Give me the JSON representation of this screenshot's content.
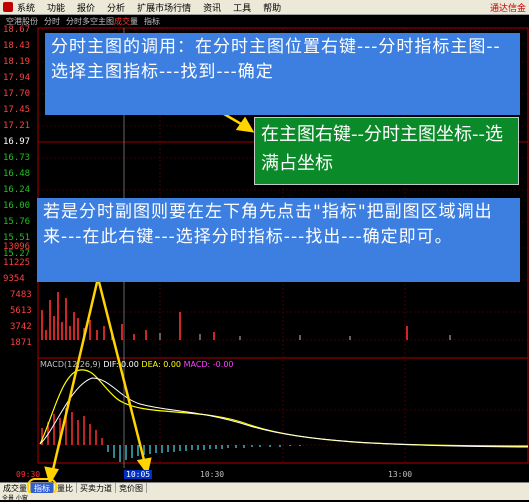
{
  "menubar": {
    "items": [
      "系统",
      "功能",
      "报价",
      "分析",
      "扩展市场行情",
      "资讯",
      "工具",
      "帮助"
    ],
    "right_text": "通达信金"
  },
  "toolbar": {
    "stock_name": "空港股份",
    "items": [
      "分时",
      "分时多空主图"
    ],
    "highlight": "成交",
    "item_after": "量",
    "last": "指标"
  },
  "price_axis": [
    "18.67",
    "18.43",
    "18.19",
    "17.94",
    "17.70",
    "17.45",
    "17.21",
    "16.97",
    "16.73",
    "16.48",
    "16.24",
    "16.00",
    "15.76",
    "15.51",
    "15.27"
  ],
  "volume_axis": [
    "13096",
    "11225",
    "9354",
    "7483",
    "5613",
    "3742",
    "1871"
  ],
  "macd_label": {
    "name": "MACD(12,26,9)",
    "dif": "DIF: 0.00",
    "dea": "DEA: 0.00",
    "macd": "MACD: -0.00"
  },
  "time_axis": {
    "start": "09:30",
    "cursor": "10:05",
    "t1": "10:30",
    "t2": "13:00"
  },
  "callouts": {
    "main": "分时主图的调用：在分时主图位置右键---分时指标主图--选择主图指标---找到---确定",
    "green": "在主图右键--分时主图坐标--选满占坐标",
    "sub": "若是分时副图则要在左下角先点击\"指标\"把副图区域调出来---在此右键---选择分时指标---找出---确定即可。"
  },
  "tabs": [
    "成交量",
    "指标",
    "量比",
    "买卖力道",
    "竞价图"
  ],
  "active_tab": "指标",
  "bottom_text": "全景  小窗"
}
